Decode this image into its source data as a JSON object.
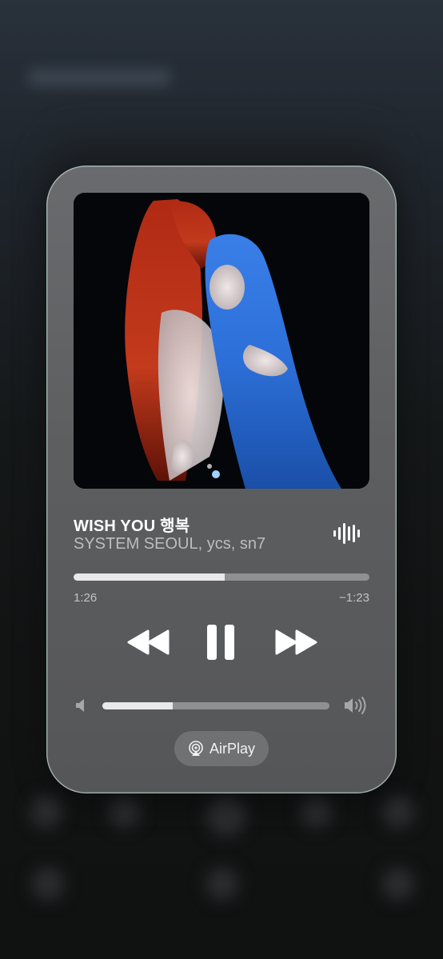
{
  "now_playing": {
    "title": "WISH YOU 행복",
    "artist": "SYSTEM SEOUL, ycs, sn7"
  },
  "playback": {
    "elapsed": "1:26",
    "remaining": "−1:23",
    "progress_fraction": 0.51,
    "state": "playing"
  },
  "volume": {
    "level_fraction": 0.31
  },
  "airplay": {
    "label": "AirPlay"
  },
  "icons": {
    "waveform": "waveform-icon",
    "rewind": "backward-icon",
    "pause": "pause-icon",
    "forward": "forward-icon",
    "volume_low": "speaker-low-icon",
    "volume_high": "speaker-high-icon",
    "airplay": "airplay-icon"
  },
  "colors": {
    "card_bg": "#5f6062",
    "track": "#8f9092",
    "fill": "#e9e9eb",
    "artist_text": "#bdbdbf"
  }
}
